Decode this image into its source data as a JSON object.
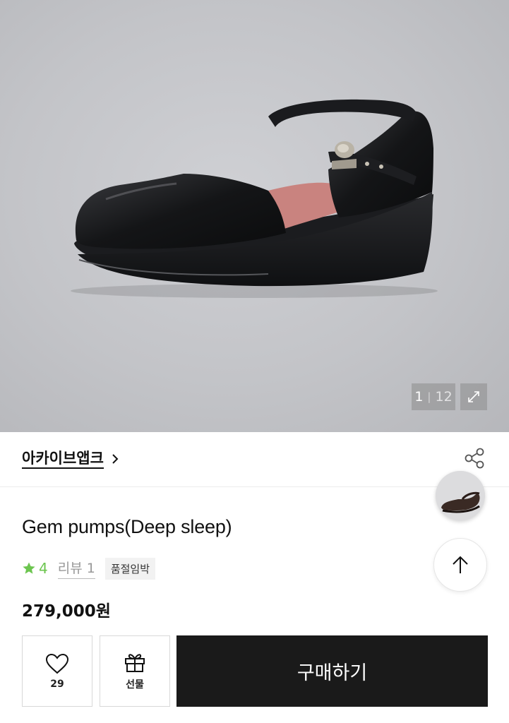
{
  "gallery": {
    "current": "1",
    "separator": "|",
    "total": "12"
  },
  "brand": {
    "name": "아카이브앱크"
  },
  "product": {
    "title": "Gem pumps(Deep sleep)",
    "rating": "4",
    "review_label": "리뷰 1",
    "status_badge": "품절임박",
    "price": "279,000원"
  },
  "actions": {
    "like_count": "29",
    "gift_label": "선물",
    "buy_label": "구매하기"
  },
  "colors": {
    "accent_green": "#6cc54f",
    "buy_button": "#1a1a1a"
  },
  "icons": [
    "expand-icon",
    "chevron-right-icon",
    "share-icon",
    "arrow-up-icon",
    "star-icon",
    "heart-icon",
    "gift-icon"
  ]
}
